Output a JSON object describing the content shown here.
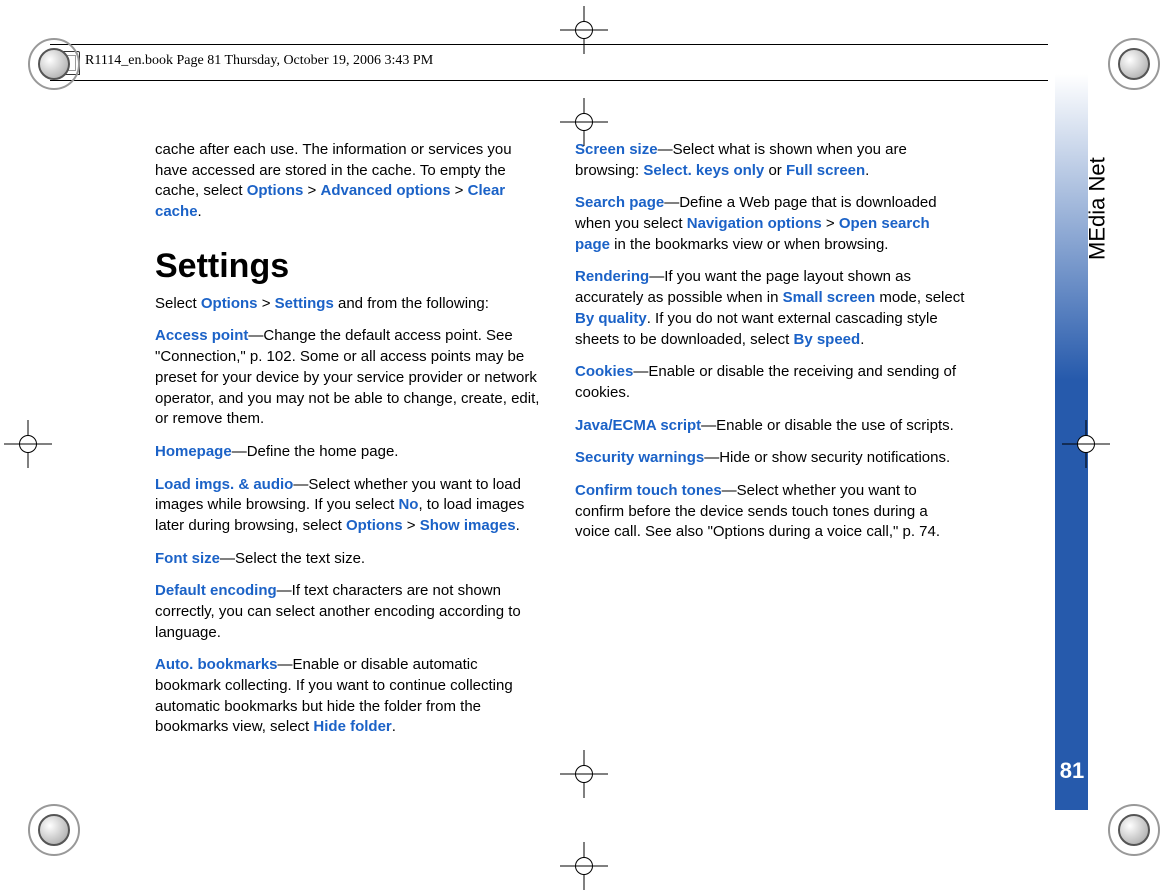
{
  "header": {
    "text": "R1114_en.book  Page 81  Thursday, October 19, 2006  3:43 PM"
  },
  "side": {
    "label": "MEdia Net",
    "page_number": "81"
  },
  "col1": {
    "p1_a": "cache after each use. The information or services you have accessed are stored in the cache. To empty the cache, select ",
    "p1_b": "Options",
    "p1_c": " > ",
    "p1_d": "Advanced options",
    "p1_e": " > ",
    "p1_f": "Clear cache",
    "p1_g": ".",
    "heading": "Settings",
    "p2_a": "Select ",
    "p2_b": "Options",
    "p2_c": " > ",
    "p2_d": "Settings",
    "p2_e": " and from the following:",
    "p3_a": "Access point",
    "p3_b": "—Change the default access point. See \"Connection,\" p. 102. Some or all access points may be preset for your device by your service provider or network operator, and you may not be able to change, create, edit, or remove them.",
    "p4_a": "Homepage",
    "p4_b": "—Define the home page.",
    "p5_a": "Load imgs. & audio",
    "p5_b": "—Select whether you want to load images while browsing. If you select ",
    "p5_c": "No",
    "p5_d": ", to load images later during browsing, select ",
    "p5_e": "Options",
    "p5_f": " > ",
    "p5_g": "Show images",
    "p5_h": ".",
    "p6_a": "Font size",
    "p6_b": "—Select the text size.",
    "p7_a": "Default encoding",
    "p7_b": "—If text characters are not shown correctly, you can select another encoding according to language.",
    "p8_a": "Auto. bookmarks",
    "p8_b": "—Enable or disable automatic bookmark collecting. If you want to continue collecting automatic bookmarks but hide the folder from the bookmarks view, select ",
    "p8_c": "Hide folder",
    "p8_d": "."
  },
  "col2": {
    "p1_a": "Screen size",
    "p1_b": "—Select what is shown when you are browsing: ",
    "p1_c": "Select. keys only",
    "p1_d": " or ",
    "p1_e": "Full screen",
    "p1_f": ".",
    "p2_a": "Search page",
    "p2_b": "—Define a Web page that is downloaded when you select ",
    "p2_c": "Navigation options",
    "p2_d": " > ",
    "p2_e": "Open search page",
    "p2_f": " in the bookmarks view or when browsing.",
    "p3_a": "Rendering",
    "p3_b": "—If you want the page layout shown as accurately as possible when in ",
    "p3_c": "Small screen",
    "p3_d": " mode, select ",
    "p3_e": "By quality",
    "p3_f": ". If you do not want external cascading style sheets to be downloaded, select ",
    "p3_g": "By speed",
    "p3_h": ".",
    "p4_a": "Cookies",
    "p4_b": "—Enable or disable the receiving and sending of cookies.",
    "p5_a": "Java/ECMA script",
    "p5_b": "—Enable or disable the use of scripts.",
    "p6_a": "Security warnings",
    "p6_b": "—Hide or show security notifications.",
    "p7_a": "Confirm touch tones",
    "p7_b": "—Select whether you want to confirm before the device sends touch tones during a voice call. See also \"Options during a voice call,\" p. 74."
  }
}
